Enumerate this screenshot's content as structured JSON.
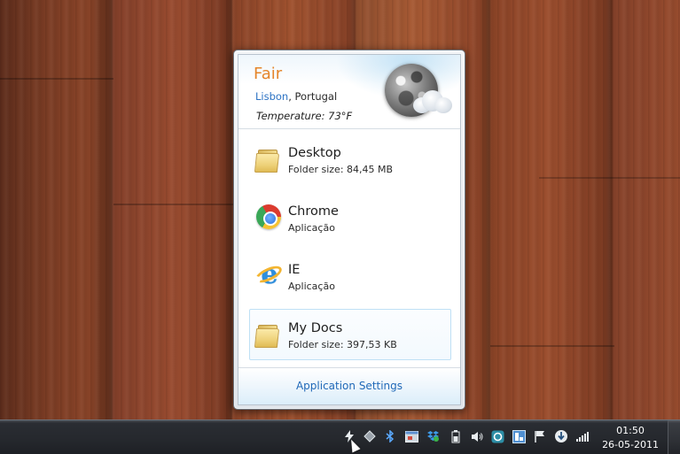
{
  "weather": {
    "condition": "Fair",
    "city": "Lisbon",
    "country_suffix": ", Portugal",
    "temperature": "Temperature: 73°F",
    "icon": "moon-cloud-icon"
  },
  "items": [
    {
      "name": "Desktop",
      "sub": "Folder size: 84,45 MB",
      "icon": "folder-icon"
    },
    {
      "name": "Chrome",
      "sub": "Aplicação",
      "icon": "chrome-icon"
    },
    {
      "name": "IE",
      "sub": "Aplicação",
      "icon": "ie-icon"
    },
    {
      "name": "My Docs",
      "sub": "Folder size: 397,53 KB",
      "icon": "folder-icon"
    }
  ],
  "footer": {
    "settings_label": "Application Settings"
  },
  "taskbar": {
    "tray_icons": [
      "lightning-icon",
      "diamond-icon",
      "bluetooth-icon",
      "window-icon",
      "dropbox-icon",
      "battery-icon",
      "volume-icon",
      "sync-icon",
      "app-icon",
      "flag-icon",
      "download-icon",
      "signal-icon"
    ],
    "time": "01:50",
    "date": "26-05-2011"
  },
  "colors": {
    "condition": "#e5852a",
    "link": "#2d73c4",
    "settings": "#2169b8",
    "taskbar": "#25282d"
  }
}
